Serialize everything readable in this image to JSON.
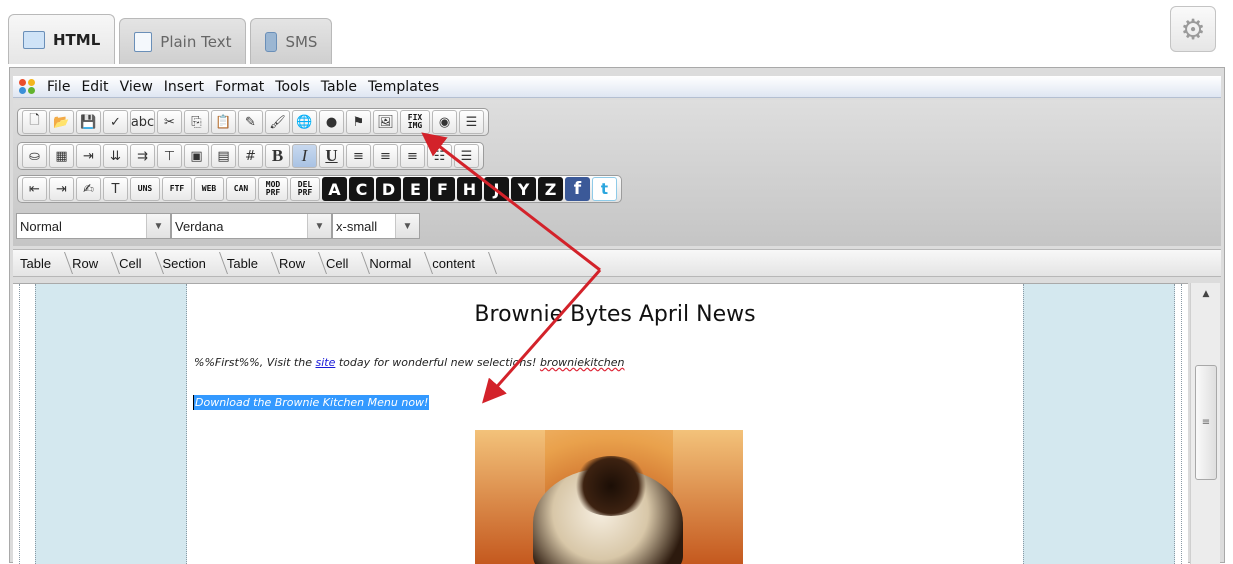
{
  "tabs": [
    {
      "label": "HTML",
      "icon": "html-icon",
      "active": true
    },
    {
      "label": "Plain Text",
      "icon": "document-icon",
      "active": false
    },
    {
      "label": "SMS",
      "icon": "phone-icon",
      "active": false
    }
  ],
  "settings_icon": "gear-icon",
  "menu": [
    "File",
    "Edit",
    "View",
    "Insert",
    "Format",
    "Tools",
    "Table",
    "Templates"
  ],
  "toolbar_rows": [
    [
      {
        "name": "new-document",
        "glyph": "🗋"
      },
      {
        "name": "open-folder",
        "glyph": "📂"
      },
      {
        "name": "save",
        "glyph": "💾"
      },
      {
        "name": "spell-check",
        "glyph": "✓"
      },
      {
        "name": "spell-check-as-you-type",
        "glyph": "abc"
      },
      {
        "name": "cut",
        "glyph": "✂"
      },
      {
        "name": "copy",
        "glyph": "⎘"
      },
      {
        "name": "paste",
        "glyph": "📋"
      },
      {
        "name": "clean-formatting",
        "glyph": "✎"
      },
      {
        "name": "format-painter",
        "glyph": "🖌"
      },
      {
        "name": "insert-hyperlink",
        "glyph": "🌐"
      },
      {
        "name": "remove-hyperlink",
        "glyph": "●"
      },
      {
        "name": "insert-anchor",
        "glyph": "⚑"
      },
      {
        "name": "insert-image",
        "glyph": "🖼"
      },
      {
        "name": "fix-image",
        "text": "FIX\nIMG"
      },
      {
        "name": "insert-media",
        "glyph": "◉"
      },
      {
        "name": "horizontal-rule",
        "glyph": "☰"
      }
    ],
    [
      {
        "name": "background-color",
        "glyph": "⛀"
      },
      {
        "name": "insert-table",
        "glyph": "▦"
      },
      {
        "name": "insert-column",
        "glyph": "⇥"
      },
      {
        "name": "insert-row",
        "glyph": "⇊"
      },
      {
        "name": "merge-cells",
        "glyph": "⇉"
      },
      {
        "name": "split-cell",
        "glyph": "⊤"
      },
      {
        "name": "table-properties",
        "glyph": "▣"
      },
      {
        "name": "show-borders",
        "glyph": "▤"
      },
      {
        "name": "show-grid",
        "glyph": "#"
      },
      {
        "name": "bold",
        "text": "B"
      },
      {
        "name": "italic",
        "text": "I"
      },
      {
        "name": "underline",
        "text": "U"
      },
      {
        "name": "align-left",
        "glyph": "≡"
      },
      {
        "name": "align-center",
        "glyph": "≡"
      },
      {
        "name": "align-right",
        "glyph": "≡"
      },
      {
        "name": "bullet-list",
        "glyph": "☷"
      },
      {
        "name": "numbered-list",
        "glyph": "☰"
      }
    ],
    [
      {
        "name": "outdent",
        "glyph": "⇤"
      },
      {
        "name": "indent",
        "glyph": "⇥"
      },
      {
        "name": "spell-marker",
        "glyph": "✍"
      },
      {
        "name": "text-color",
        "glyph": "T"
      },
      {
        "name": "unsubscribe",
        "text": "UNS"
      },
      {
        "name": "forward-to-friend",
        "text": "FTF"
      },
      {
        "name": "web-version",
        "text": "WEB"
      },
      {
        "name": "can-spam",
        "text": "CAN"
      },
      {
        "name": "modify-profile",
        "text": "MOD\nPRF"
      },
      {
        "name": "delete-profile",
        "text": "DEL\nPRF"
      },
      {
        "name": "field-a",
        "text": "A"
      },
      {
        "name": "field-c",
        "text": "C"
      },
      {
        "name": "field-d",
        "text": "D"
      },
      {
        "name": "field-e",
        "text": "E"
      },
      {
        "name": "field-f",
        "text": "F"
      },
      {
        "name": "field-h",
        "text": "H"
      },
      {
        "name": "field-j",
        "text": "J"
      },
      {
        "name": "field-y",
        "text": "Y"
      },
      {
        "name": "field-z",
        "text": "Z"
      },
      {
        "name": "facebook",
        "text": "f"
      },
      {
        "name": "twitter",
        "text": "t"
      }
    ]
  ],
  "dropdowns": {
    "format": "Normal",
    "font": "Verdana",
    "size": "x-small"
  },
  "breadcrumb": [
    "Table",
    "Row",
    "Cell",
    "Section",
    "Table",
    "Row",
    "Cell",
    "Normal",
    "content"
  ],
  "document": {
    "headline": "Brownie Bytes April News",
    "intro_before": "%%First%%, Visit the ",
    "intro_link": "site",
    "intro_after": " today for wonderful new selections! ",
    "intro_spell": "browniekitchen",
    "download_text": "Download the Brownie Kitchen Menu now!"
  },
  "colors": {
    "arrow": "#d3222a",
    "selection": "#3399ff",
    "side_panel": "#d4e8ef"
  }
}
